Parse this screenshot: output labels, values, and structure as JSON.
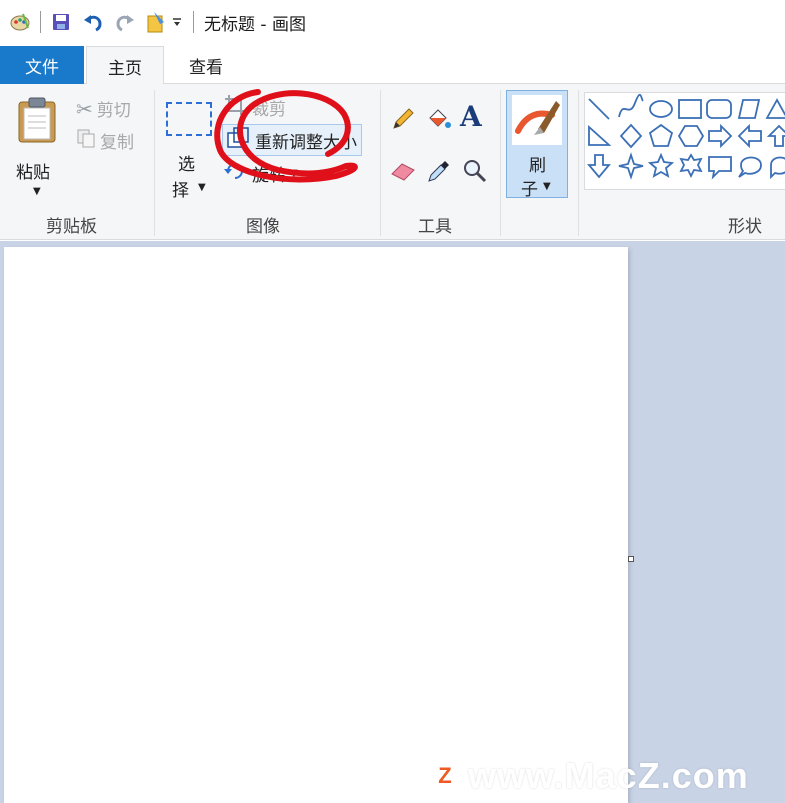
{
  "window": {
    "title": "无标题 - 画图"
  },
  "quick_access": {
    "icons": [
      "paint-app-icon",
      "save-icon",
      "undo-icon",
      "redo-icon",
      "customize-icon",
      "dropdown-icon"
    ]
  },
  "tabs": {
    "file": "文件",
    "home": "主页",
    "view": "查看"
  },
  "clipboard": {
    "paste": "粘贴",
    "cut": "剪切",
    "copy": "复制",
    "group_label": "剪贴板"
  },
  "image": {
    "select_line1": "选",
    "select_line2": "择",
    "crop": "裁剪",
    "resize": "重新调整大小",
    "rotate": "旋转",
    "group_label": "图像"
  },
  "tools": {
    "group_label": "工具",
    "text_tool": "A"
  },
  "brush": {
    "line1": "刷",
    "line2": "子"
  },
  "shapes": {
    "group_label": "形状"
  },
  "colors": {
    "accent": "#1979ca",
    "annotation": "#e0101a",
    "workspace": "#c8d3e6"
  },
  "watermark": {
    "text": "www.MacZ.com",
    "logo": "Z"
  }
}
